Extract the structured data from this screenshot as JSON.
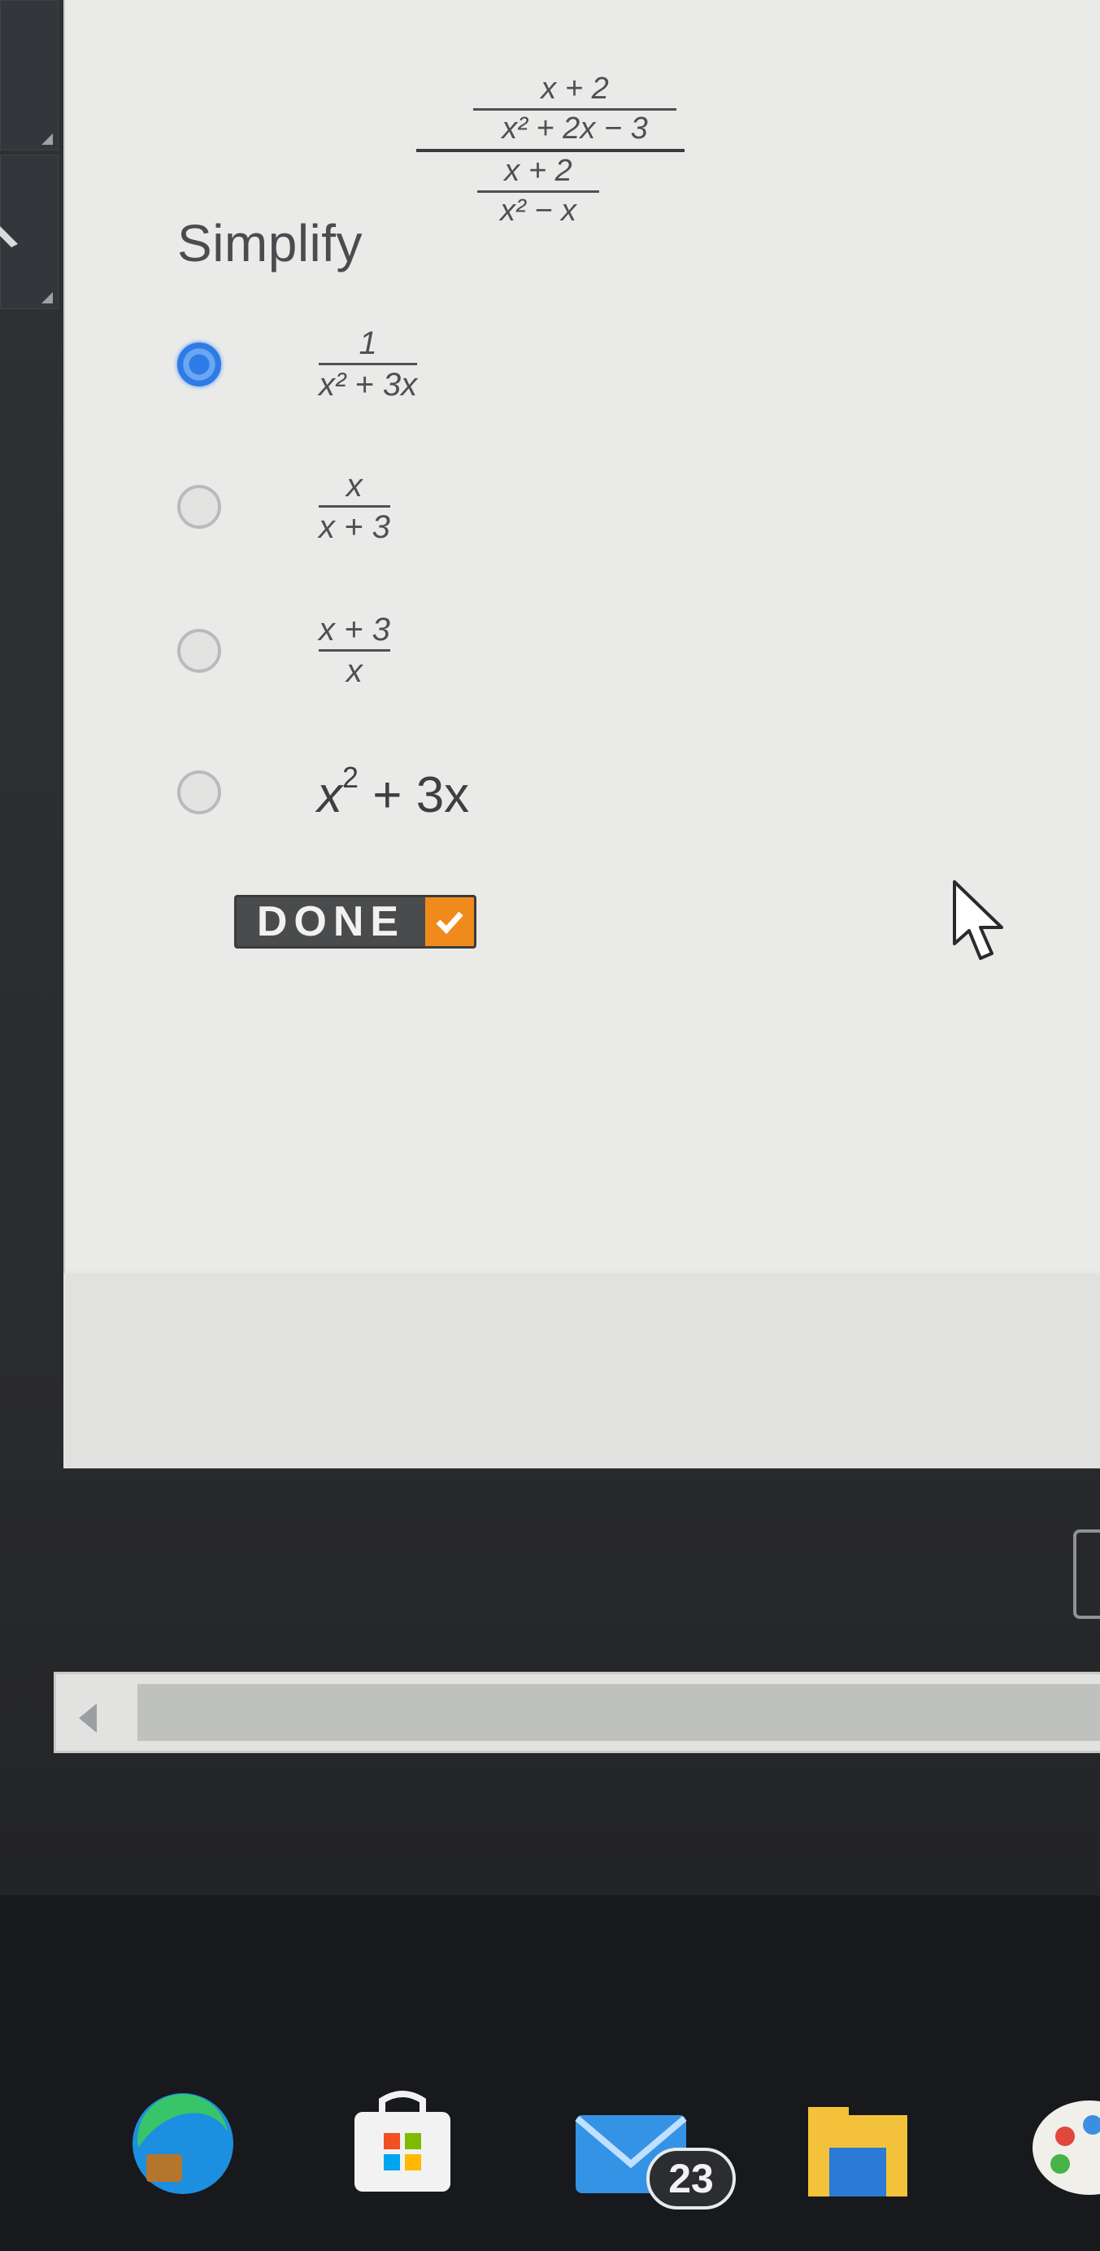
{
  "question": {
    "prompt": "Simplify",
    "expression": {
      "top_numerator": "x + 2",
      "top_denominator": "x² + 2x − 3",
      "bottom_numerator": "x + 2",
      "bottom_denominator": "x² − x"
    }
  },
  "options": [
    {
      "numerator": "1",
      "denominator": "x² + 3x",
      "selected": true
    },
    {
      "numerator": "x",
      "denominator": "x + 3",
      "selected": false
    },
    {
      "numerator": "x + 3",
      "denominator": "x",
      "selected": false
    },
    {
      "text_base": "x",
      "text_exp": "2",
      "text_rest": " + 3x",
      "selected": false
    }
  ],
  "done_button": {
    "label": "DONE"
  },
  "taskbar": {
    "icons": [
      "edge-browser-icon",
      "microsoft-store-icon",
      "mail-icon",
      "file-explorer-icon",
      "paint-icon"
    ],
    "mail_badge": "23"
  },
  "colors": {
    "accent_blue": "#2f7be6",
    "done_orange": "#f08a1d",
    "panel_bg": "#eaebe9"
  }
}
